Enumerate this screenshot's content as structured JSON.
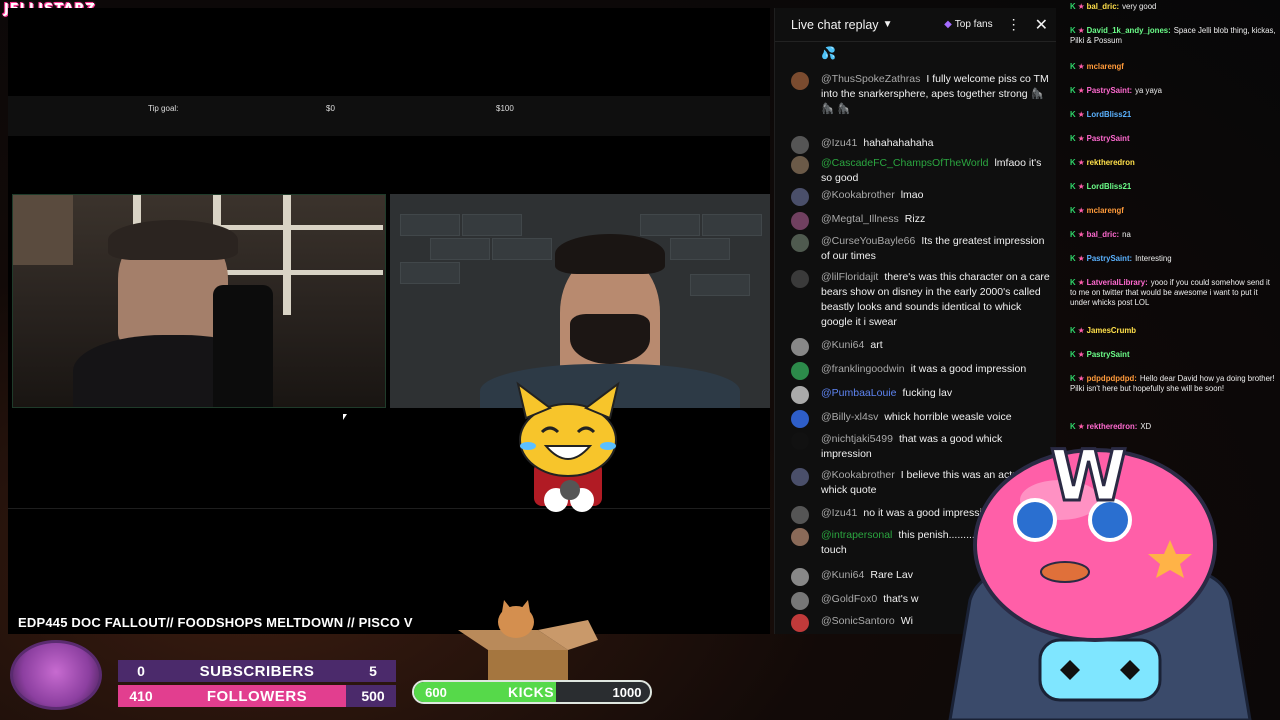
{
  "brand": "JELLISTARZ",
  "player": {
    "tip_goal_label": "Tip goal:",
    "tip_min": "$0",
    "tip_max": "$100",
    "video_title": "EDP445 DOC FALLOUT// FOODSHOPS MELTDOWN // PISCO V"
  },
  "chat": {
    "title": "Live chat replay",
    "top_fans": "Top fans",
    "messages": [
      {
        "name": "@ThusSpokeZathras",
        "text": "I fully welcome piss co TM into the snarkersphere, apes together strong 🦍 🦍 🦍",
        "color": "gray"
      },
      {
        "name": "@Izu41",
        "text": "hahahahahaha",
        "color": "gray"
      },
      {
        "name": "@CascadeFC_ChampsOfTheWorld",
        "text": "lmfaoo it's so good",
        "color": "green"
      },
      {
        "name": "@Kookabrother",
        "text": "lmao",
        "color": "gray"
      },
      {
        "name": "@Megtal_Illness",
        "text": "Rizz",
        "color": "gray"
      },
      {
        "name": "@CurseYouBayle66",
        "text": "Its the greatest impression of our times",
        "color": "gray"
      },
      {
        "name": "@lilFloridajit",
        "text": "there's was this character on a care bears show on disney in the early 2000's called beastly looks and sounds identical to whick google it i swear",
        "color": "gray"
      },
      {
        "name": "@Kuni64",
        "text": "art",
        "color": "gray"
      },
      {
        "name": "@franklingoodwin",
        "text": "it was a good impression",
        "color": "gray"
      },
      {
        "name": "@PumbaaLouie",
        "text": "fucking lav",
        "color": "blue"
      },
      {
        "name": "@Billy-xl4sv",
        "text": "whick horrible weasle voice",
        "color": "gray"
      },
      {
        "name": "@nichtjaki5499",
        "text": "that was a good whick impression",
        "color": "gray"
      },
      {
        "name": "@Kookabrother",
        "text": "I believe this was an actual whick quote",
        "color": "gray"
      },
      {
        "name": "@Izu41",
        "text": "no it was a good impression",
        "color": "gray"
      },
      {
        "name": "@intrapersonal",
        "text": "this penish......... u dont have to touch",
        "color": "green"
      },
      {
        "name": "@Kuni64",
        "text": "Rare Lav",
        "color": "gray"
      },
      {
        "name": "@GoldFox0",
        "text": "that's w",
        "color": "gray"
      },
      {
        "name": "@SonicSantoro",
        "text": "Wi",
        "color": "gray"
      }
    ]
  },
  "side_chat": [
    {
      "name": "bal_dric",
      "text": "very good"
    },
    {
      "name": "David_1k_andy_jones",
      "text": "Space Jelli blob thing, kickas, Pilki & Possum"
    },
    {
      "name": "mclarengf",
      "text": ""
    },
    {
      "name": "PastrySaint",
      "text": "ya yaya"
    },
    {
      "name": "LordBliss21",
      "text": ""
    },
    {
      "name": "PastrySaint",
      "text": ""
    },
    {
      "name": "rektheredron",
      "text": ""
    },
    {
      "name": "LordBliss21",
      "text": ""
    },
    {
      "name": "mclarengf",
      "text": ""
    },
    {
      "name": "bal_dric",
      "text": "na"
    },
    {
      "name": "PastrySaint",
      "text": "Interesting"
    },
    {
      "name": "LatverialLibrary",
      "text": "yooo if you could somehow send it to me on twitter that would be awesome i want to put it under whicks post LOL"
    },
    {
      "name": "JamesCrumb",
      "text": ""
    },
    {
      "name": "PastrySaint",
      "text": ""
    },
    {
      "name": "pdpdpdpdpd",
      "text": "Hello dear David how ya doing brother! Pilki isn't here but hopefully she will be soon!"
    },
    {
      "name": "rektheredron",
      "text": "XD"
    }
  ],
  "stats": {
    "subscribers": {
      "label": "SUBSCRIBERS",
      "current": "0",
      "goal": "5",
      "progress": 0.0
    },
    "followers": {
      "label": "FOLLOWERS",
      "current": "410",
      "goal": "500",
      "progress": 0.82
    },
    "kicks": {
      "label": "KICKS",
      "current": "600",
      "goal": "1000",
      "progress": 0.6
    }
  },
  "colors": {
    "accent_pink": "#e23e8f",
    "kicks_green": "#56d94a",
    "chat_bg": "#0f0f0f"
  }
}
